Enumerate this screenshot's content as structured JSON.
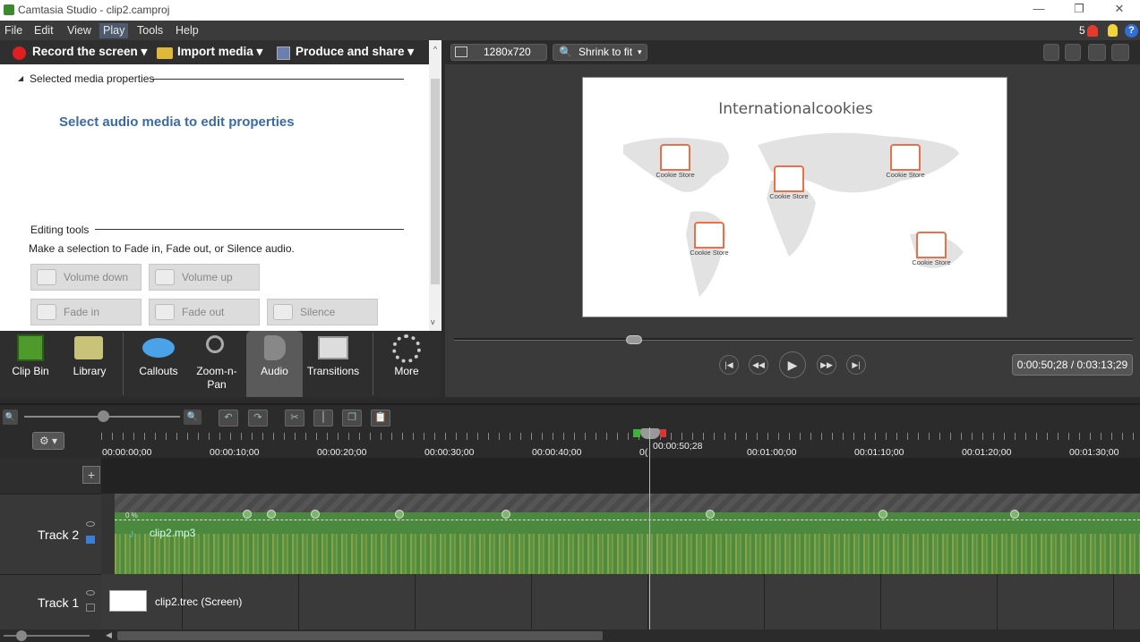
{
  "window": {
    "title": "Camtasia Studio - clip2.camproj"
  },
  "menu": [
    "File",
    "Edit",
    "View",
    "Play",
    "Tools",
    "Help"
  ],
  "notifications": {
    "count": "5"
  },
  "toolbar": {
    "record": "Record the screen",
    "import": "Import media",
    "produce": "Produce and share"
  },
  "properties": {
    "section_title": "Selected media properties",
    "message": "Select audio media to edit properties",
    "editing_title": "Editing tools",
    "editing_hint": "Make a selection to Fade in, Fade out, or Silence audio.",
    "buttons": {
      "volume_down": "Volume down",
      "volume_up": "Volume up",
      "fade_in": "Fade in",
      "fade_out": "Fade out",
      "silence": "Silence"
    }
  },
  "tabs": [
    {
      "label": "Clip Bin"
    },
    {
      "label": "Library"
    },
    {
      "label": "Callouts"
    },
    {
      "label": "Zoom-n-Pan"
    },
    {
      "label": "Audio"
    },
    {
      "label": "Transitions"
    },
    {
      "label": "More"
    }
  ],
  "preview": {
    "dimensions": "1280x720",
    "zoom": "Shrink to fit",
    "slide_title": "Internationalcookies",
    "store_label": "Cookie Store",
    "time": "0:00:50;28 / 0:03:13;29"
  },
  "timeline": {
    "ticks": [
      "00:00:00;00",
      "00:00:10;00",
      "00:00:20;00",
      "00:00:30;00",
      "00:00:40;00",
      "00:01:00;00",
      "00:01:10;00",
      "00:01:20;00",
      "00:01:30;00"
    ],
    "playhead_label": "00:00:50;28",
    "playhead_prefix": "0(",
    "track2": {
      "name": "Track 2",
      "clip": "clip2.mp3",
      "percent": "0 %"
    },
    "track1": {
      "name": "Track 1",
      "clip": "clip2.trec (Screen)"
    }
  },
  "colors": {
    "accent_orange": "#e8704a",
    "record_red": "#e02020",
    "audio_green": "#4b8a3e"
  }
}
